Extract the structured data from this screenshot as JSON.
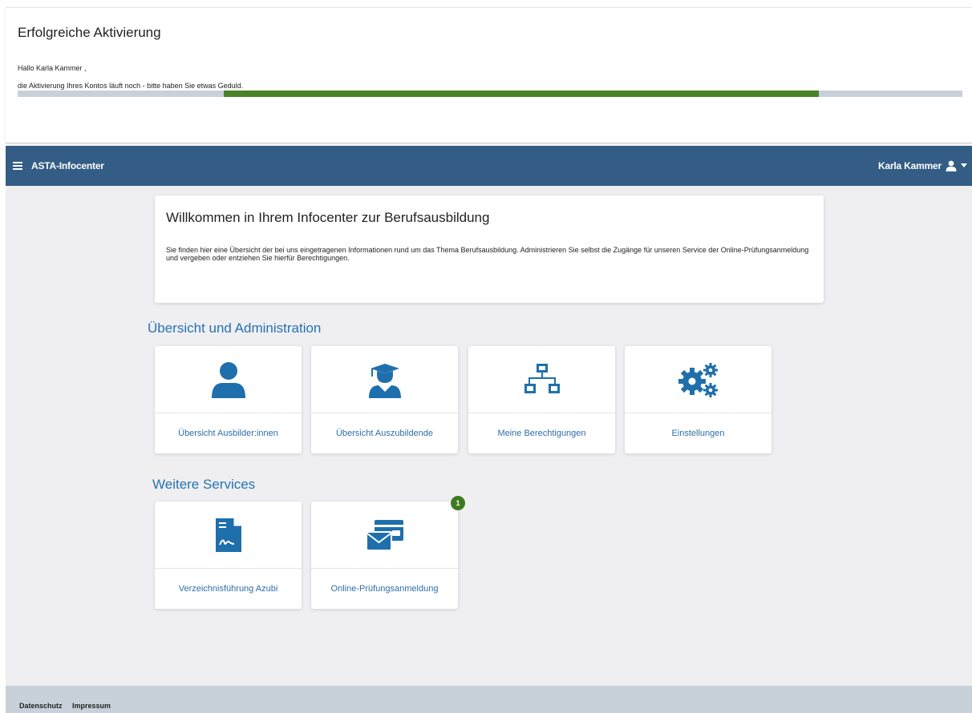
{
  "notice": {
    "title": "Erfolgreiche Aktivierung",
    "greeting": "Hallo Karla Kammer ,",
    "message": "die Aktivierung Ihres Kontos läuft noch - bitte haben Sie etwas Geduld.",
    "progress": {
      "start": 0.218,
      "end": 0.848,
      "fill_color": "#4a8228",
      "track_color": "#c8d1da"
    }
  },
  "topbar": {
    "menu_icon": "hamburger-menu-icon",
    "title": "ASTA-Infocenter",
    "user_name": "Karla Kammer",
    "user_icon": "user-icon",
    "dropdown_icon": "caret-down-icon",
    "color": "#345d85"
  },
  "welcome": {
    "title": "Willkommen in Ihrem Infocenter zur Berufsausbildung",
    "text": "Sie finden hier eine Übersicht der bei uns eingetragenen Informationen rund um das Thema Berufsausbildung. Administrieren Sie selbst die Zugänge für unseren Service der Online-Prüfungsanmeldung und vergeben oder entziehen Sie hierfür Berechtigungen."
  },
  "sections": {
    "overview": {
      "title": "Übersicht und Administration",
      "tiles": [
        {
          "label": "Übersicht Ausbilder:innen",
          "icon": "user-icon"
        },
        {
          "label": "Übersicht Auszubildende",
          "icon": "graduate-user-icon"
        },
        {
          "label": "Meine Berechtigungen",
          "icon": "network-icon"
        },
        {
          "label": "Einstellungen",
          "icon": "gears-icon"
        }
      ]
    },
    "services": {
      "title": "Weitere Services",
      "tiles": [
        {
          "label": "Verzeichnisführung Azubi",
          "icon": "signed-document-icon"
        },
        {
          "label": "Online-Prüfungsanmeldung",
          "icon": "envelope-wallet-icon",
          "badge": "1"
        }
      ]
    }
  },
  "footer": {
    "links": [
      "Datenschutz",
      "Impressum"
    ]
  },
  "colors": {
    "accent": "#2672b3",
    "icon": "#1f6fac",
    "badge": "#3f7a21",
    "background": "#efeff1"
  }
}
